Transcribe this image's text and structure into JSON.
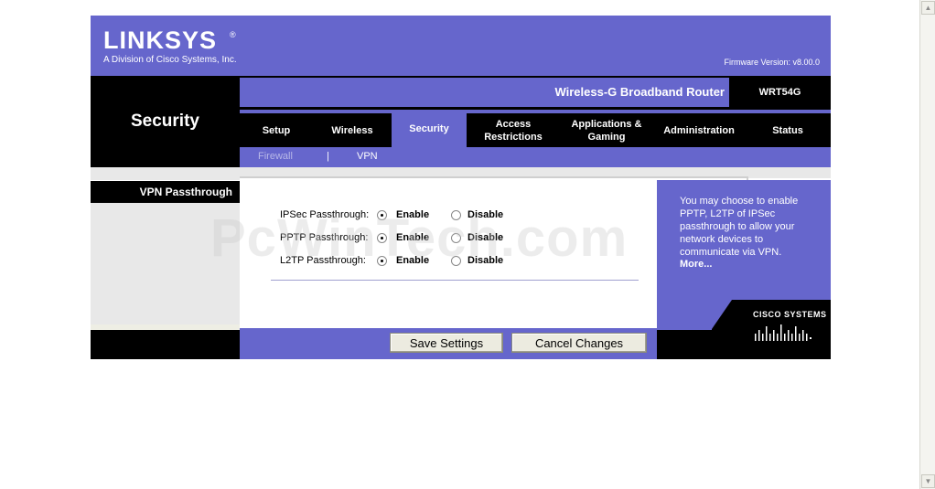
{
  "header": {
    "logo": "LINKSYS",
    "tagline": "A Division of Cisco Systems, Inc.",
    "firmware": "Firmware Version: v8.00.0"
  },
  "topbar": {
    "product_name": "Wireless-G Broadband Router",
    "model": "WRT54G"
  },
  "section_title": "Security",
  "tabs": [
    {
      "label": "Setup",
      "active": false
    },
    {
      "label": "Wireless",
      "active": false
    },
    {
      "label": "Security",
      "active": true
    },
    {
      "label": "Access Restrictions",
      "active": false
    },
    {
      "label": "Applications & Gaming",
      "active": false
    },
    {
      "label": "Administration",
      "active": false
    },
    {
      "label": "Status",
      "active": false
    }
  ],
  "subtabs": {
    "firewall": "Firewall",
    "separator": "|",
    "vpn": "VPN"
  },
  "left_label": "VPN Passthrough",
  "settings": [
    {
      "label": "IPSec Passthrough:",
      "enable": "Enable",
      "disable": "Disable",
      "selected": "Enable"
    },
    {
      "label": "PPTP Passthrough:",
      "enable": "Enable",
      "disable": "Disable",
      "selected": "Enable"
    },
    {
      "label": "L2TP Passthrough:",
      "enable": "Enable",
      "disable": "Disable",
      "selected": "Enable"
    }
  ],
  "help": {
    "text": "You may choose to enable PPTP, L2TP of IPSec passthrough to allow your network devices to communicate via VPN.",
    "more": "More..."
  },
  "cisco_logo": "CISCO SYSTEMS",
  "buttons": {
    "save": "Save Settings",
    "cancel": "Cancel Changes"
  },
  "watermark": "PcWinTech.com",
  "colors": {
    "brand_purple": "#6666cc",
    "black": "#000000",
    "panel_gray": "#e8e8e8"
  }
}
